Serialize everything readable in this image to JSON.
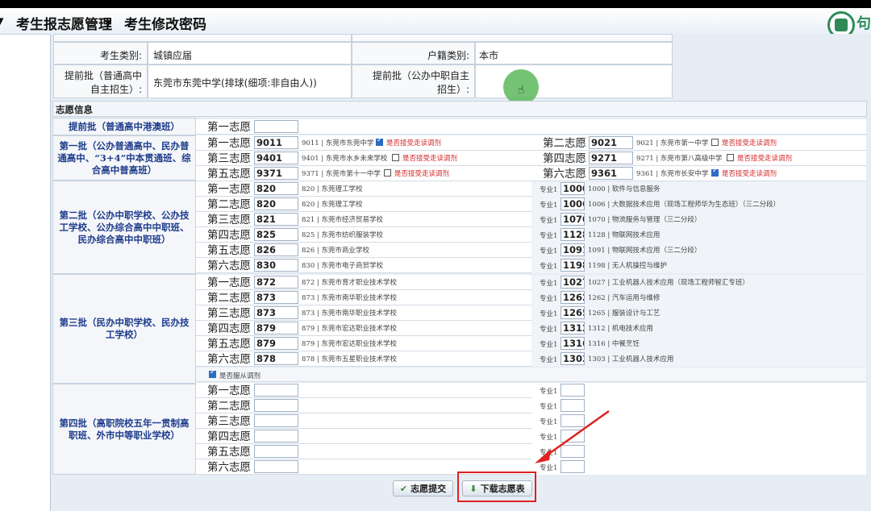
{
  "menu": [
    "考生报志愿管理",
    "考生修改密码"
  ],
  "logo_text": "句",
  "info": {
    "category_label": "考生类别:",
    "category_value": "城镇应届",
    "household_label": "户籍类别:",
    "household_value": "本市",
    "early_general_label": "提前批（普通高中自主招生）:",
    "early_general_value": "东莞市东莞中学(排球(细项:非自由人))",
    "early_vocational_label": "提前批（公办中职自主招生）:",
    "early_vocational_value": ""
  },
  "section_title": "志愿信息",
  "batches": {
    "early": "提前批（普通高中港澳班）",
    "first": "第一批（公办普通高中、民办普通高中、“3+4”中本贯通班、综合高中普高班）",
    "second": "第二批（公办中职学校、公办技工学校、公办综合高中中职班、民办综合高中中职班）",
    "third": "第三批（民办中职学校、民办技工学校）",
    "fourth": "第四批（高职院校五年一贯制高职班、外市中等职业学校）"
  },
  "choice_labels": [
    "第一志愿",
    "第二志愿",
    "第三志愿",
    "第四志愿",
    "第五志愿",
    "第六志愿"
  ],
  "accept_label": "是否接受走读调剂",
  "first_batch": [
    {
      "code": "9011",
      "desc": "9011 | 东莞市东莞中学",
      "accept": true
    },
    {
      "code": "9021",
      "desc": "9021 | 东莞市第一中学",
      "accept": false
    },
    {
      "code": "9401",
      "desc": "9401 | 东莞市水乡未来学校",
      "accept": false
    },
    {
      "code": "9271",
      "desc": "9271 | 东莞市第八高级中学",
      "accept": false
    },
    {
      "code": "9371",
      "desc": "9371 | 东莞市第十一中学",
      "accept": false
    },
    {
      "code": "9361",
      "desc": "9361 | 东莞市长安中学",
      "accept": true
    }
  ],
  "major_label": "专业1",
  "second_batch": [
    {
      "code": "820",
      "desc": "820 | 东莞理工学校",
      "major": "1000",
      "major_desc": "1000 | 软件与信息服务"
    },
    {
      "code": "820",
      "desc": "820 | 东莞理工学校",
      "major": "1006",
      "major_desc": "1006 | 大数据技术应用（现场工程师华为生态班）（三二分段）"
    },
    {
      "code": "821",
      "desc": "821 | 东莞市经济贸易学校",
      "major": "1070",
      "major_desc": "1070 | 物流服务与管理（三二分段）"
    },
    {
      "code": "825",
      "desc": "825 | 东莞市纺织服装学校",
      "major": "1128",
      "major_desc": "1128 | 物联网技术应用"
    },
    {
      "code": "826",
      "desc": "826 | 东莞市商业学校",
      "major": "1091",
      "major_desc": "1091 | 物联网技术应用（三二分段）"
    },
    {
      "code": "830",
      "desc": "830 | 东莞市电子商贸学校",
      "major": "1198",
      "major_desc": "1198 | 无人机操控与维护"
    }
  ],
  "third_batch": [
    {
      "code": "872",
      "desc": "872 | 东莞市育才职业技术学校",
      "major": "1027",
      "major_desc": "1027 | 工业机器人技术应用（现场工程师智汇专班）"
    },
    {
      "code": "873",
      "desc": "873 | 东莞市南华职业技术学校",
      "major": "1262",
      "major_desc": "1262 | 汽车运用与维修"
    },
    {
      "code": "873",
      "desc": "873 | 东莞市南华职业技术学校",
      "major": "1265",
      "major_desc": "1265 | 服装设计与工艺"
    },
    {
      "code": "879",
      "desc": "879 | 东莞市宏达职业技术学校",
      "major": "1312",
      "major_desc": "1312 | 机电技术应用"
    },
    {
      "code": "879",
      "desc": "879 | 东莞市宏达职业技术学校",
      "major": "1316",
      "major_desc": "1316 | 中餐烹饪"
    },
    {
      "code": "878",
      "desc": "878 | 东莞市五星职业技术学校",
      "major": "1303",
      "major_desc": "1303 | 工业机器人技术应用"
    }
  ],
  "obey_label": "是否服从调剂",
  "obey_checked": true,
  "buttons": {
    "submit": "志愿提交",
    "download": "下载志愿表"
  }
}
